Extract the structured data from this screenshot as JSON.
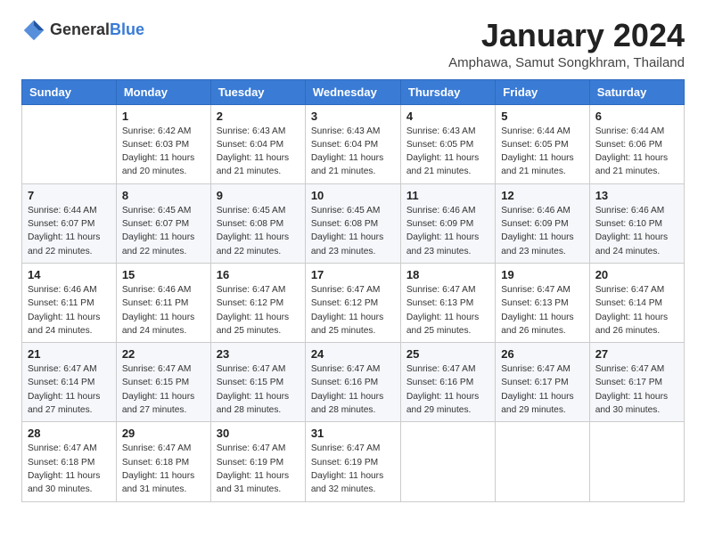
{
  "header": {
    "logo_general": "General",
    "logo_blue": "Blue",
    "title": "January 2024",
    "location": "Amphawa, Samut Songkhram, Thailand"
  },
  "columns": [
    "Sunday",
    "Monday",
    "Tuesday",
    "Wednesday",
    "Thursday",
    "Friday",
    "Saturday"
  ],
  "weeks": [
    [
      {
        "day": "",
        "info": ""
      },
      {
        "day": "1",
        "info": "Sunrise: 6:42 AM\nSunset: 6:03 PM\nDaylight: 11 hours\nand 20 minutes."
      },
      {
        "day": "2",
        "info": "Sunrise: 6:43 AM\nSunset: 6:04 PM\nDaylight: 11 hours\nand 21 minutes."
      },
      {
        "day": "3",
        "info": "Sunrise: 6:43 AM\nSunset: 6:04 PM\nDaylight: 11 hours\nand 21 minutes."
      },
      {
        "day": "4",
        "info": "Sunrise: 6:43 AM\nSunset: 6:05 PM\nDaylight: 11 hours\nand 21 minutes."
      },
      {
        "day": "5",
        "info": "Sunrise: 6:44 AM\nSunset: 6:05 PM\nDaylight: 11 hours\nand 21 minutes."
      },
      {
        "day": "6",
        "info": "Sunrise: 6:44 AM\nSunset: 6:06 PM\nDaylight: 11 hours\nand 21 minutes."
      }
    ],
    [
      {
        "day": "7",
        "info": "Sunrise: 6:44 AM\nSunset: 6:07 PM\nDaylight: 11 hours\nand 22 minutes."
      },
      {
        "day": "8",
        "info": "Sunrise: 6:45 AM\nSunset: 6:07 PM\nDaylight: 11 hours\nand 22 minutes."
      },
      {
        "day": "9",
        "info": "Sunrise: 6:45 AM\nSunset: 6:08 PM\nDaylight: 11 hours\nand 22 minutes."
      },
      {
        "day": "10",
        "info": "Sunrise: 6:45 AM\nSunset: 6:08 PM\nDaylight: 11 hours\nand 23 minutes."
      },
      {
        "day": "11",
        "info": "Sunrise: 6:46 AM\nSunset: 6:09 PM\nDaylight: 11 hours\nand 23 minutes."
      },
      {
        "day": "12",
        "info": "Sunrise: 6:46 AM\nSunset: 6:09 PM\nDaylight: 11 hours\nand 23 minutes."
      },
      {
        "day": "13",
        "info": "Sunrise: 6:46 AM\nSunset: 6:10 PM\nDaylight: 11 hours\nand 24 minutes."
      }
    ],
    [
      {
        "day": "14",
        "info": "Sunrise: 6:46 AM\nSunset: 6:11 PM\nDaylight: 11 hours\nand 24 minutes."
      },
      {
        "day": "15",
        "info": "Sunrise: 6:46 AM\nSunset: 6:11 PM\nDaylight: 11 hours\nand 24 minutes."
      },
      {
        "day": "16",
        "info": "Sunrise: 6:47 AM\nSunset: 6:12 PM\nDaylight: 11 hours\nand 25 minutes."
      },
      {
        "day": "17",
        "info": "Sunrise: 6:47 AM\nSunset: 6:12 PM\nDaylight: 11 hours\nand 25 minutes."
      },
      {
        "day": "18",
        "info": "Sunrise: 6:47 AM\nSunset: 6:13 PM\nDaylight: 11 hours\nand 25 minutes."
      },
      {
        "day": "19",
        "info": "Sunrise: 6:47 AM\nSunset: 6:13 PM\nDaylight: 11 hours\nand 26 minutes."
      },
      {
        "day": "20",
        "info": "Sunrise: 6:47 AM\nSunset: 6:14 PM\nDaylight: 11 hours\nand 26 minutes."
      }
    ],
    [
      {
        "day": "21",
        "info": "Sunrise: 6:47 AM\nSunset: 6:14 PM\nDaylight: 11 hours\nand 27 minutes."
      },
      {
        "day": "22",
        "info": "Sunrise: 6:47 AM\nSunset: 6:15 PM\nDaylight: 11 hours\nand 27 minutes."
      },
      {
        "day": "23",
        "info": "Sunrise: 6:47 AM\nSunset: 6:15 PM\nDaylight: 11 hours\nand 28 minutes."
      },
      {
        "day": "24",
        "info": "Sunrise: 6:47 AM\nSunset: 6:16 PM\nDaylight: 11 hours\nand 28 minutes."
      },
      {
        "day": "25",
        "info": "Sunrise: 6:47 AM\nSunset: 6:16 PM\nDaylight: 11 hours\nand 29 minutes."
      },
      {
        "day": "26",
        "info": "Sunrise: 6:47 AM\nSunset: 6:17 PM\nDaylight: 11 hours\nand 29 minutes."
      },
      {
        "day": "27",
        "info": "Sunrise: 6:47 AM\nSunset: 6:17 PM\nDaylight: 11 hours\nand 30 minutes."
      }
    ],
    [
      {
        "day": "28",
        "info": "Sunrise: 6:47 AM\nSunset: 6:18 PM\nDaylight: 11 hours\nand 30 minutes."
      },
      {
        "day": "29",
        "info": "Sunrise: 6:47 AM\nSunset: 6:18 PM\nDaylight: 11 hours\nand 31 minutes."
      },
      {
        "day": "30",
        "info": "Sunrise: 6:47 AM\nSunset: 6:19 PM\nDaylight: 11 hours\nand 31 minutes."
      },
      {
        "day": "31",
        "info": "Sunrise: 6:47 AM\nSunset: 6:19 PM\nDaylight: 11 hours\nand 32 minutes."
      },
      {
        "day": "",
        "info": ""
      },
      {
        "day": "",
        "info": ""
      },
      {
        "day": "",
        "info": ""
      }
    ]
  ]
}
